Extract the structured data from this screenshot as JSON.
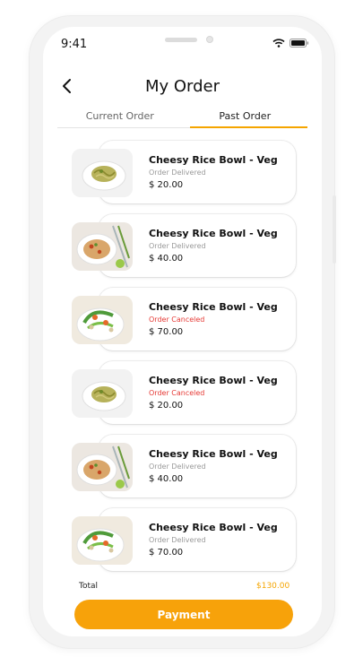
{
  "status_bar": {
    "time": "9:41",
    "icons": [
      "wifi-icon",
      "battery-icon"
    ]
  },
  "header": {
    "title": "My Order",
    "back_icon": "chevron-left-icon"
  },
  "tabs": [
    {
      "label": "Current Order",
      "active": false
    },
    {
      "label": "Past Order",
      "active": true
    }
  ],
  "orders": [
    {
      "name": "Cheesy Rice Bowl - Veg",
      "status": "Order Delivered",
      "status_type": "delivered",
      "price": "$ 20.00",
      "image": "pasta-dish"
    },
    {
      "name": "Cheesy Rice Bowl - Veg",
      "status": "Order Delivered",
      "status_type": "delivered",
      "price": "$ 40.00",
      "image": "rice-bowl"
    },
    {
      "name": "Cheesy Rice Bowl - Veg",
      "status": "Order Canceled",
      "status_type": "canceled",
      "price": "$ 70.00",
      "image": "salad-dish"
    },
    {
      "name": "Cheesy Rice Bowl - Veg",
      "status": "Order Canceled",
      "status_type": "canceled",
      "price": "$ 20.00",
      "image": "pasta-dish"
    },
    {
      "name": "Cheesy Rice Bowl - Veg",
      "status": "Order Delivered",
      "status_type": "delivered",
      "price": "$ 40.00",
      "image": "rice-bowl"
    },
    {
      "name": "Cheesy Rice Bowl - Veg",
      "status": "Order Delivered",
      "status_type": "delivered",
      "price": "$ 70.00",
      "image": "salad-dish"
    }
  ],
  "summary": {
    "total_label": "Total",
    "total_value": "$130.00"
  },
  "payment_button": "Payment",
  "colors": {
    "accent": "#f7a20a",
    "canceled": "#e53935",
    "delivered": "#9a9a9a"
  }
}
